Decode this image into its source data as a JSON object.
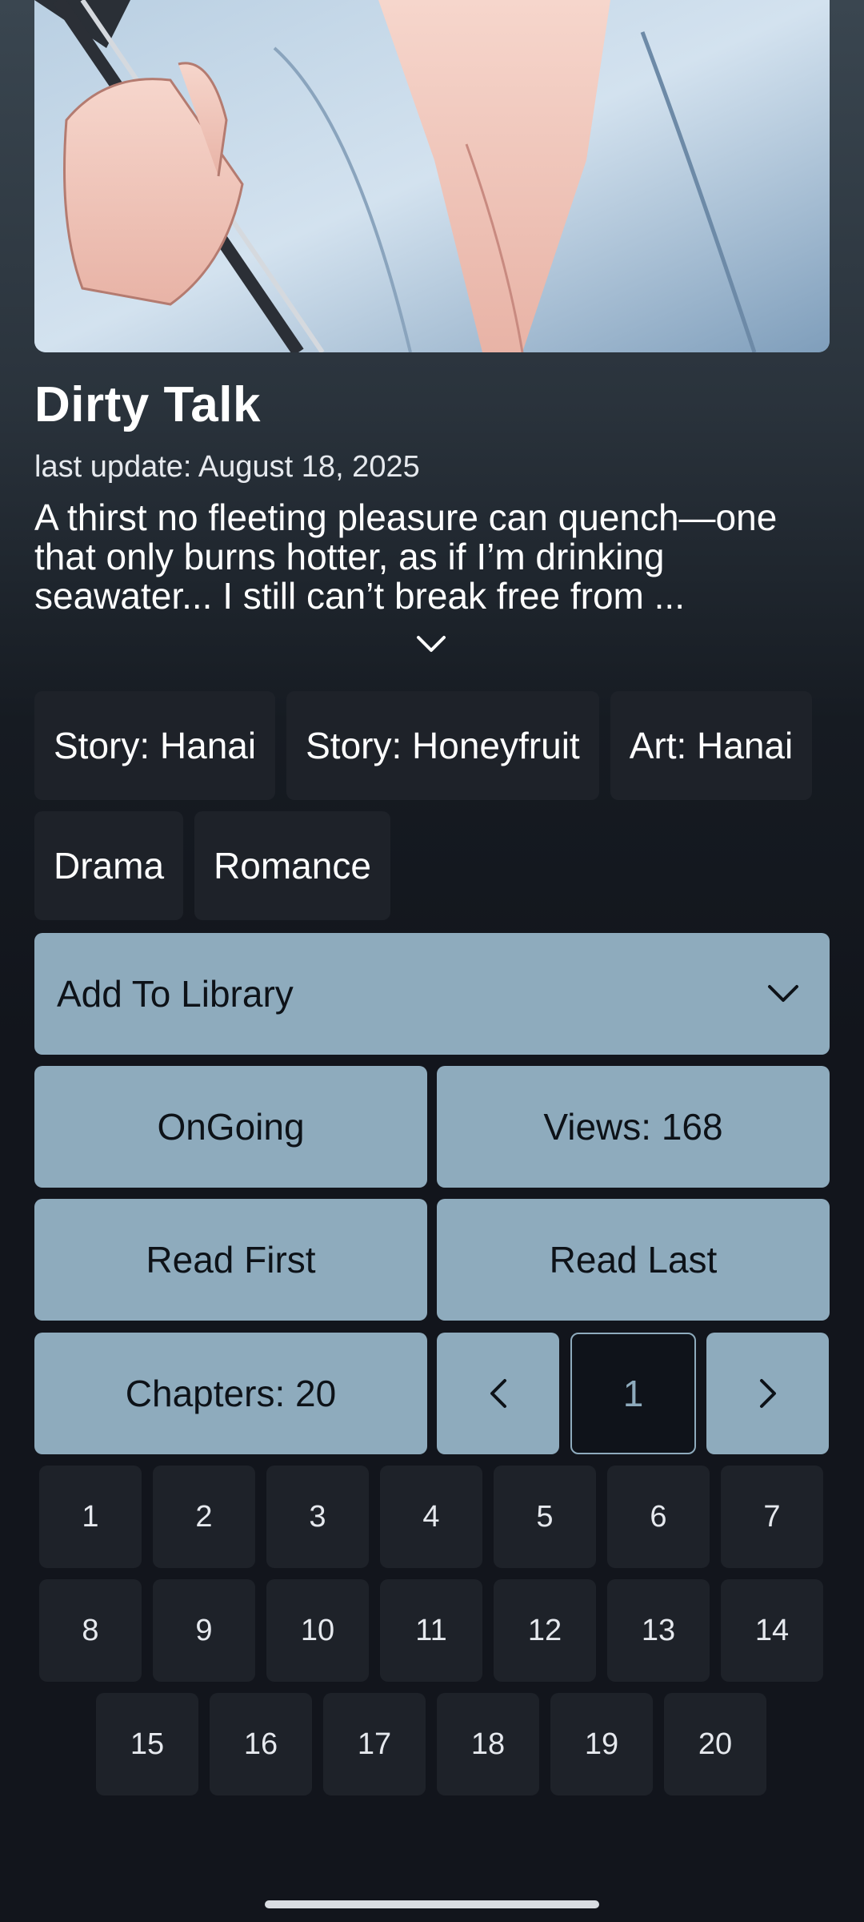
{
  "manga": {
    "title": "Dirty Talk",
    "last_update": "last update: August 18, 2025",
    "description": "A thirst no fleeting pleasure can quench—one that only burns hotter, as if I’m drinking seawater... I still can’t break free from ..."
  },
  "credits": [
    "Story: Hanai",
    "Story: Honeyfruit",
    "Art: Hanai"
  ],
  "genres": [
    "Drama",
    "Romance"
  ],
  "actions": {
    "add_to_library": "Add To Library",
    "status": "OnGoing",
    "views": "Views: 168",
    "read_first": "Read First",
    "read_last": "Read Last",
    "chapters": "Chapters: 20",
    "current_page": "1"
  },
  "chapter_numbers": [
    "1",
    "2",
    "3",
    "4",
    "5",
    "6",
    "7",
    "8",
    "9",
    "10",
    "11",
    "12",
    "13",
    "14",
    "15",
    "16",
    "17",
    "18",
    "19",
    "20"
  ],
  "icons": {
    "expand": "chevron-down-icon",
    "library_dropdown": "chevron-down-icon",
    "prev": "chevron-left-icon",
    "next": "chevron-right-icon"
  },
  "colors": {
    "accent": "#8eabbd",
    "chip_bg": "#1e2229",
    "background": "#12151c"
  }
}
